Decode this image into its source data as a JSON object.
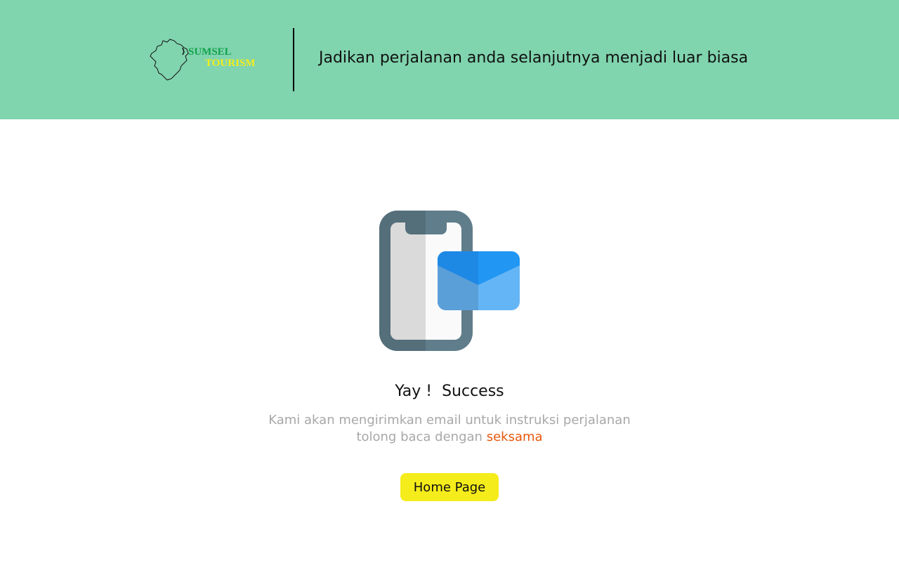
{
  "header": {
    "logo": {
      "line1": "SUMSEL",
      "line2": "TOURISM"
    },
    "tagline": "Jadikan perjalanan anda selanjutnya menjadi luar biasa",
    "background_color": "#80d4ae"
  },
  "illustration": {
    "icon": "phone-with-envelope-icon"
  },
  "success": {
    "title": "Yay !  Success",
    "message_line1": "Kami akan mengirimkan email untuk instruksi perjalanan",
    "message_line2_prefix": "tolong baca dengan ",
    "message_line2_highlight": "seksama",
    "highlight_color": "#e8570c"
  },
  "actions": {
    "home_button_label": "Home Page",
    "home_button_color": "#f5ec1b"
  }
}
